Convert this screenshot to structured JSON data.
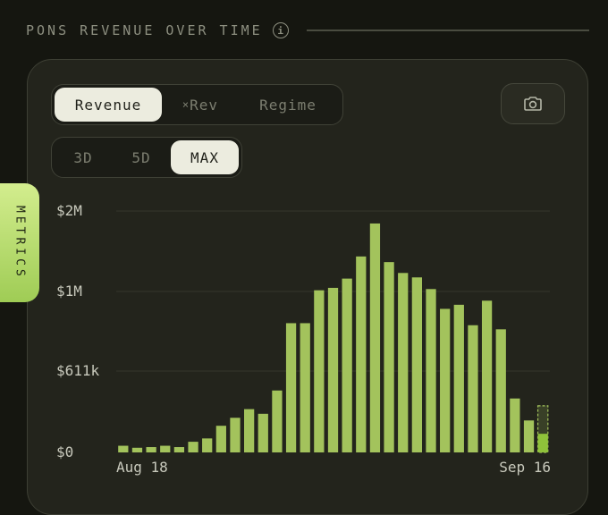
{
  "header": {
    "title": "PONS REVENUE OVER TIME",
    "info_icon_glyph": "i"
  },
  "metric_tabs": [
    {
      "label": "Revenue",
      "active": true
    },
    {
      "label_prefix": "×",
      "label": "Rev",
      "active": false
    },
    {
      "label": "Regime",
      "active": false
    }
  ],
  "range_tabs": [
    {
      "label": "3D",
      "active": false
    },
    {
      "label": "5D",
      "active": false
    },
    {
      "label": "MAX",
      "active": true
    }
  ],
  "camera_button": {
    "icon": "camera-icon"
  },
  "side_tab": {
    "label": "METRICS",
    "icon": ""
  },
  "colors": {
    "bar": "#a3c35c",
    "bar_highlight": "#8fc23a",
    "background": "#151610",
    "card": "#23241c",
    "accent_tab": "#b9dd6f"
  },
  "chart_data": {
    "type": "bar",
    "xlabel": "",
    "ylabel": "",
    "y_ticks": [
      {
        "label": "$0",
        "value": 0
      },
      {
        "label": "$611k",
        "value": 611000
      },
      {
        "label": "$1M",
        "value": 1000000
      },
      {
        "label": "$2M",
        "value": 2000000
      }
    ],
    "x_tick_labels": [
      "Aug 18",
      "Sep 16"
    ],
    "grid": true,
    "series": [
      {
        "values": [
          50000,
          35000,
          40000,
          50000,
          40000,
          80000,
          105000,
          200000,
          260000,
          325000,
          290000,
          465000,
          845000,
          845000,
          1015000,
          1045000,
          1160000,
          1435000,
          1845000,
          1365000,
          1230000,
          1175000,
          1030000,
          915000,
          935000,
          835000,
          955000,
          815000,
          405000,
          240000
        ]
      }
    ],
    "last_bar_partial": {
      "value": 140000,
      "projected": 350000
    }
  }
}
